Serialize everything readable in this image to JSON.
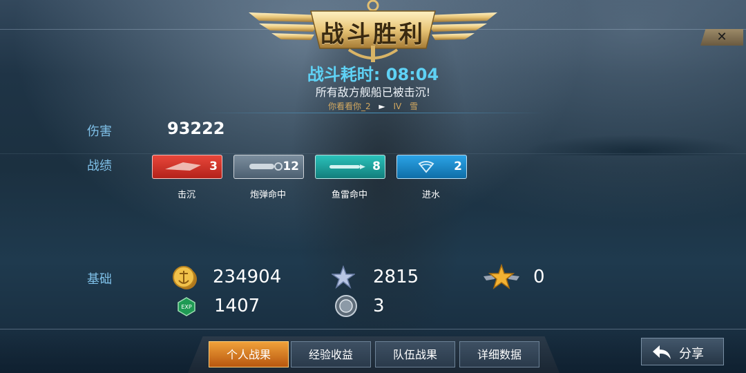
{
  "header": {
    "title": "战斗胜利",
    "close_icon": "close-icon"
  },
  "summary": {
    "duration_label": "战斗耗时: 08:04",
    "result_text": "所有敌方舰船已被击沉!",
    "player_name": "你看看你_2",
    "arrow": "►",
    "rank": "IV",
    "ship": "雪"
  },
  "damage": {
    "label": "伤害",
    "value": "93222"
  },
  "record": {
    "label": "战绩",
    "badges": [
      {
        "name": "击沉",
        "count": "3",
        "color": "#d8342a",
        "icon": "sunk-ship-icon"
      },
      {
        "name": "炮弹命中",
        "count": "12",
        "color": "#5f7283",
        "icon": "shell-icon"
      },
      {
        "name": "鱼雷命中",
        "count": "8",
        "color": "#1fa8a3",
        "icon": "torpedo-icon"
      },
      {
        "name": "进水",
        "count": "2",
        "color": "#1b8fd0",
        "icon": "flooding-icon"
      }
    ]
  },
  "basic": {
    "label": "基础",
    "gold": "234904",
    "silver_star": "2815",
    "gold_star": "0",
    "exp": "1407",
    "medal": "3"
  },
  "tabs": [
    {
      "label": "个人战果",
      "active": true
    },
    {
      "label": "经验收益",
      "active": false
    },
    {
      "label": "队伍战果",
      "active": false
    },
    {
      "label": "详细数据",
      "active": false
    }
  ],
  "share": {
    "label": "分享"
  }
}
